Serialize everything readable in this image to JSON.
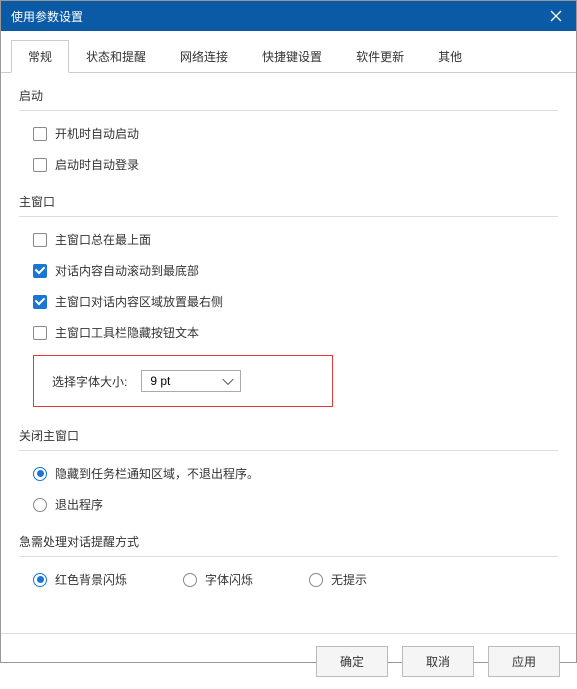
{
  "window": {
    "title": "使用参数设置"
  },
  "tabs": [
    {
      "label": "常规",
      "active": true
    },
    {
      "label": "状态和提醒",
      "active": false
    },
    {
      "label": "网络连接",
      "active": false
    },
    {
      "label": "快捷键设置",
      "active": false
    },
    {
      "label": "软件更新",
      "active": false
    },
    {
      "label": "其他",
      "active": false
    }
  ],
  "sections": {
    "startup": {
      "title": "启动",
      "items": [
        {
          "label": "开机时自动启动",
          "checked": false
        },
        {
          "label": "启动时自动登录",
          "checked": false
        }
      ]
    },
    "mainWindow": {
      "title": "主窗口",
      "items": [
        {
          "label": "主窗口总在最上面",
          "checked": false
        },
        {
          "label": "对话内容自动滚动到最底部",
          "checked": true
        },
        {
          "label": "主窗口对话内容区域放置最右侧",
          "checked": true
        },
        {
          "label": "主窗口工具栏隐藏按钮文本",
          "checked": false
        }
      ],
      "fontSize": {
        "label": "选择字体大小:",
        "value": "9 pt"
      }
    },
    "closeMain": {
      "title": "关闭主窗口",
      "items": [
        {
          "label": "隐藏到任务栏通知区域，不退出程序。",
          "checked": true
        },
        {
          "label": "退出程序",
          "checked": false
        }
      ]
    },
    "urgent": {
      "title": "急需处理对话提醒方式",
      "items": [
        {
          "label": "红色背景闪烁",
          "checked": true
        },
        {
          "label": "字体闪烁",
          "checked": false
        },
        {
          "label": "无提示",
          "checked": false
        }
      ]
    }
  },
  "footer": {
    "ok": "确定",
    "cancel": "取消",
    "apply": "应用"
  }
}
